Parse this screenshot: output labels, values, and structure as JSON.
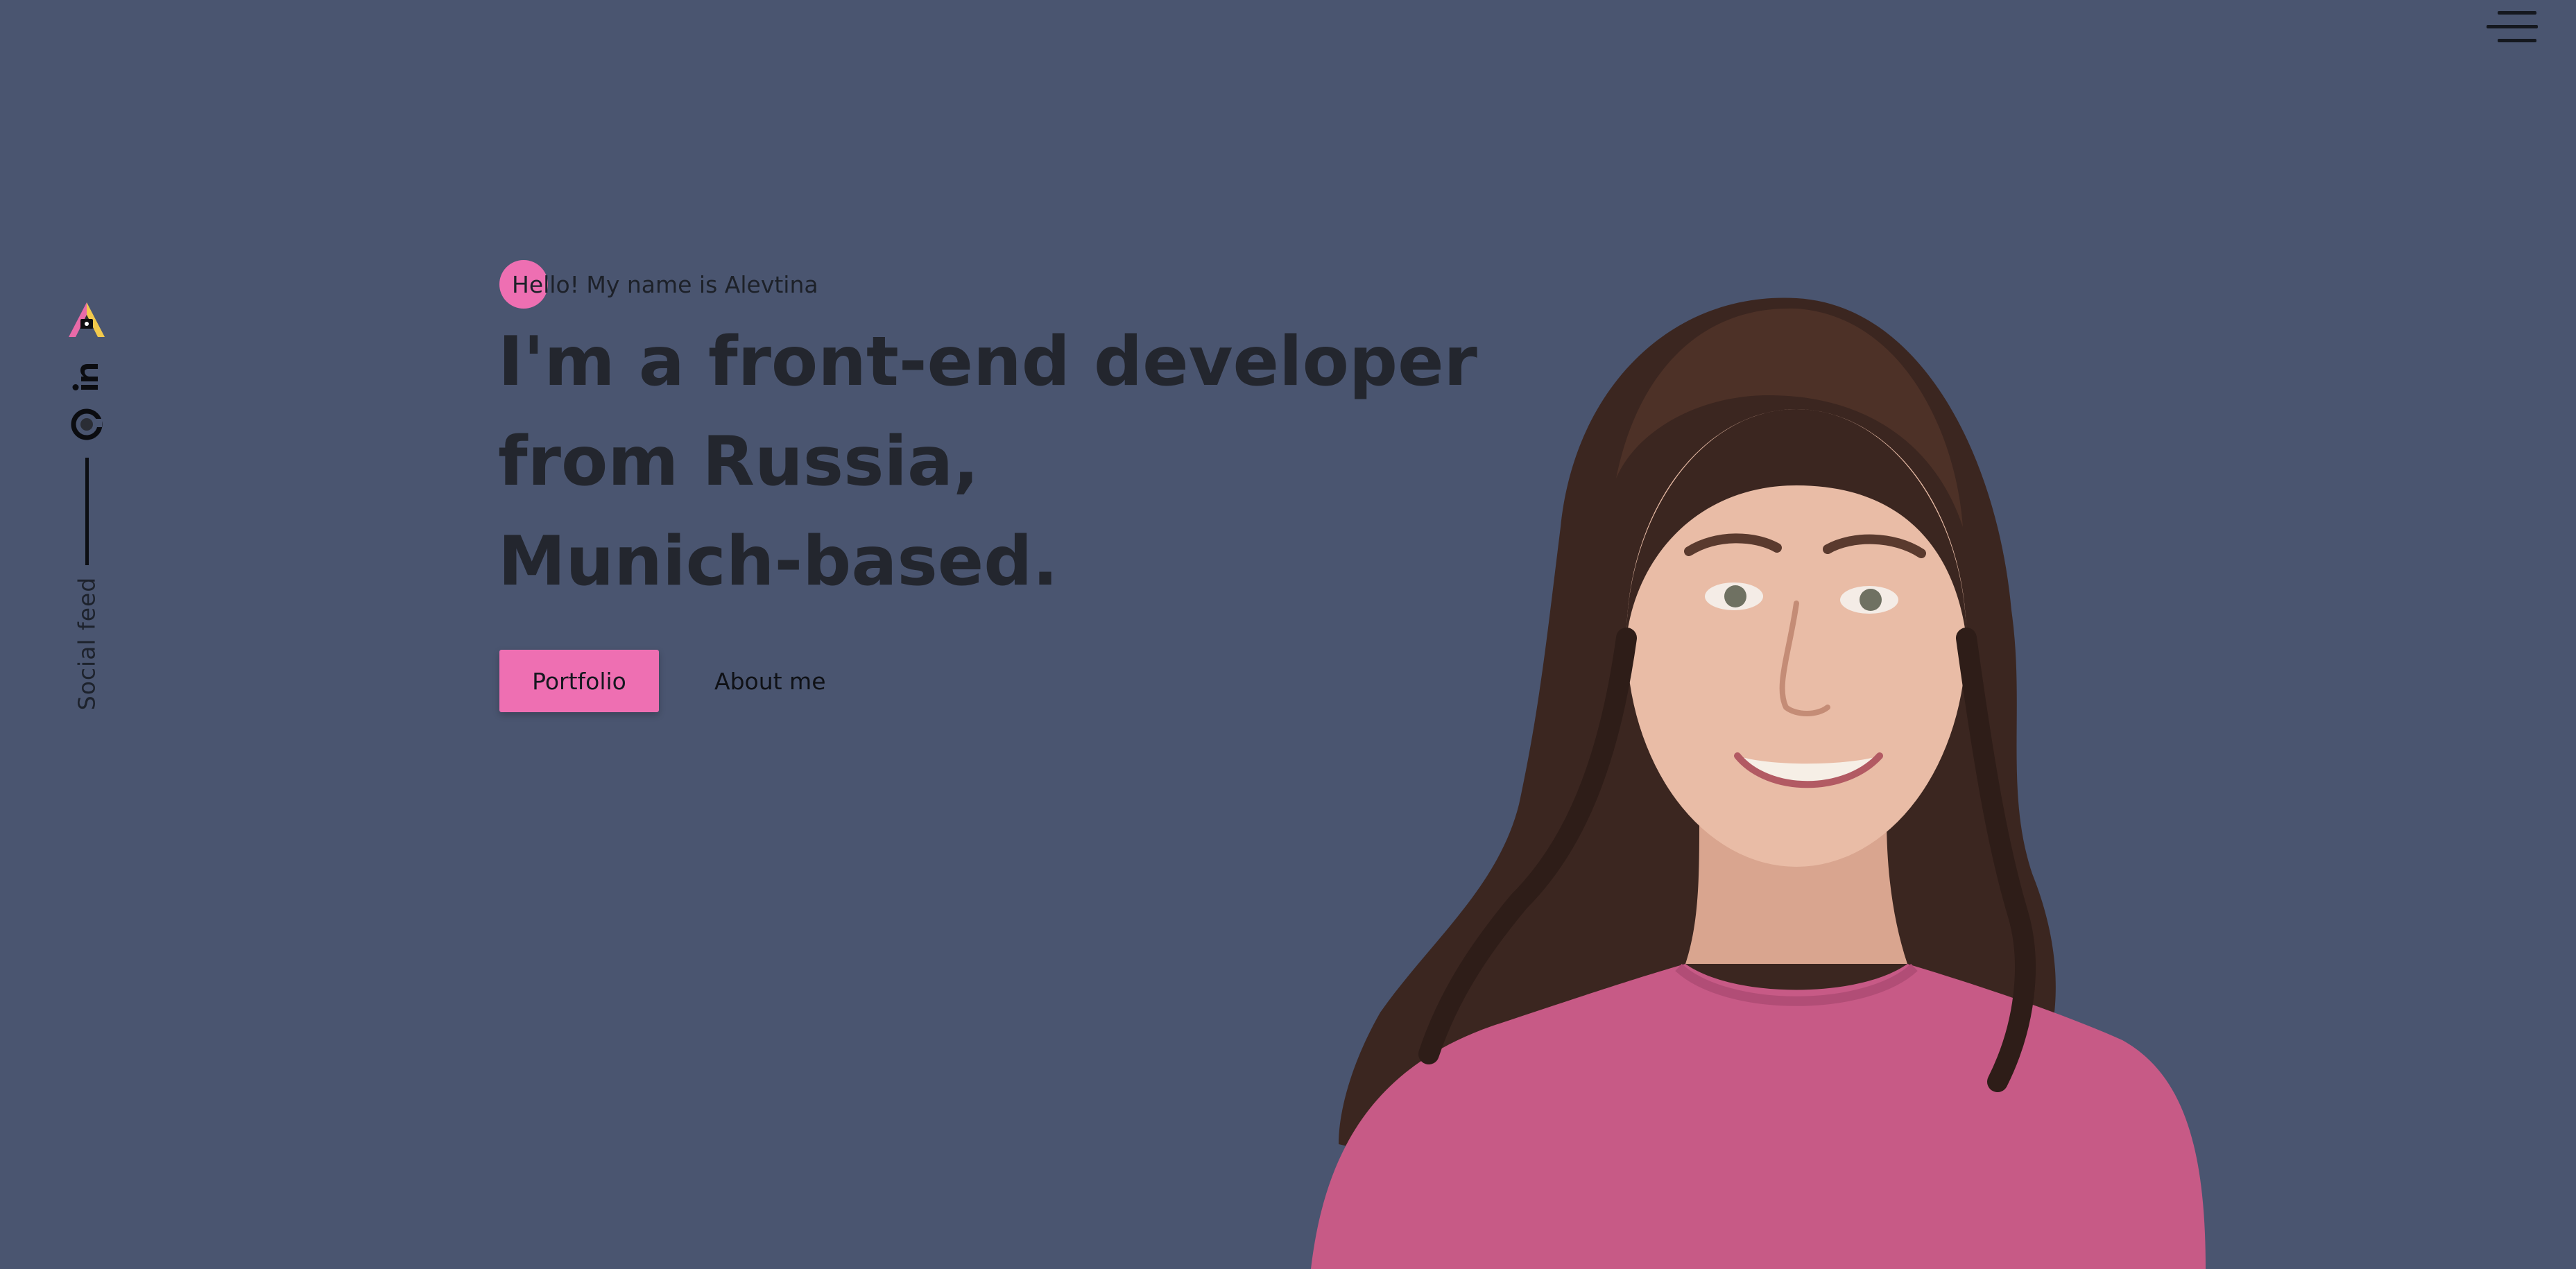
{
  "nav": {
    "menu_icon": "hamburger-menu-icon"
  },
  "social": {
    "label": "Social feed",
    "icons": [
      "angellist-icon",
      "linkedin-icon",
      "github-icon"
    ]
  },
  "hero": {
    "greeting": "Hello! My name is Alevtina",
    "headline": [
      "I'm a front-end developer",
      "from Russia,",
      "Munich-based."
    ],
    "portfolio_label": "Portfolio",
    "about_label": "About me"
  },
  "colors": {
    "background": "#4a5570",
    "accent": "#ee6fb2",
    "text_dark": "#23262e"
  }
}
